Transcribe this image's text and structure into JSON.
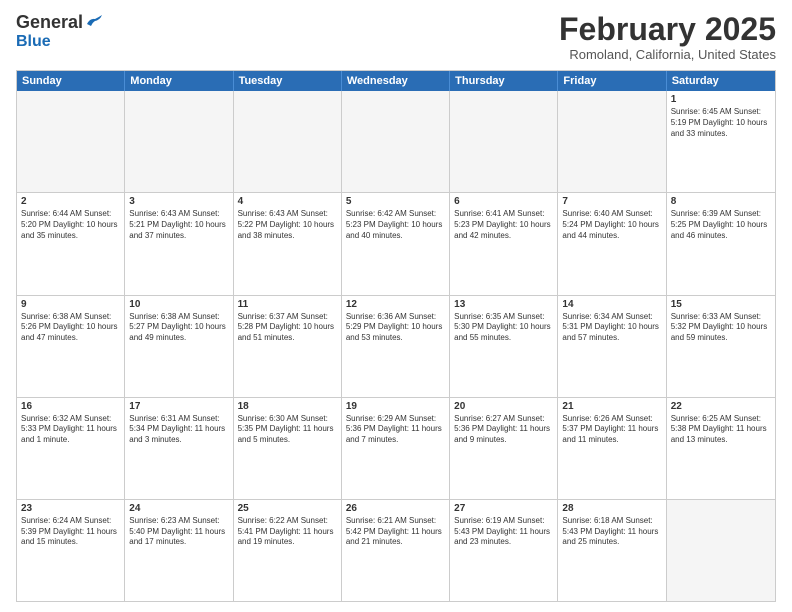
{
  "header": {
    "logo": {
      "general": "General",
      "blue": "Blue"
    },
    "title": "February 2025",
    "location": "Romoland, California, United States"
  },
  "calendar": {
    "days_of_week": [
      "Sunday",
      "Monday",
      "Tuesday",
      "Wednesday",
      "Thursday",
      "Friday",
      "Saturday"
    ],
    "rows": [
      [
        {
          "day": "",
          "empty": true,
          "text": ""
        },
        {
          "day": "",
          "empty": true,
          "text": ""
        },
        {
          "day": "",
          "empty": true,
          "text": ""
        },
        {
          "day": "",
          "empty": true,
          "text": ""
        },
        {
          "day": "",
          "empty": true,
          "text": ""
        },
        {
          "day": "",
          "empty": true,
          "text": ""
        },
        {
          "day": "1",
          "empty": false,
          "text": "Sunrise: 6:45 AM\nSunset: 5:19 PM\nDaylight: 10 hours and 33 minutes."
        }
      ],
      [
        {
          "day": "2",
          "empty": false,
          "text": "Sunrise: 6:44 AM\nSunset: 5:20 PM\nDaylight: 10 hours and 35 minutes."
        },
        {
          "day": "3",
          "empty": false,
          "text": "Sunrise: 6:43 AM\nSunset: 5:21 PM\nDaylight: 10 hours and 37 minutes."
        },
        {
          "day": "4",
          "empty": false,
          "text": "Sunrise: 6:43 AM\nSunset: 5:22 PM\nDaylight: 10 hours and 38 minutes."
        },
        {
          "day": "5",
          "empty": false,
          "text": "Sunrise: 6:42 AM\nSunset: 5:23 PM\nDaylight: 10 hours and 40 minutes."
        },
        {
          "day": "6",
          "empty": false,
          "text": "Sunrise: 6:41 AM\nSunset: 5:23 PM\nDaylight: 10 hours and 42 minutes."
        },
        {
          "day": "7",
          "empty": false,
          "text": "Sunrise: 6:40 AM\nSunset: 5:24 PM\nDaylight: 10 hours and 44 minutes."
        },
        {
          "day": "8",
          "empty": false,
          "text": "Sunrise: 6:39 AM\nSunset: 5:25 PM\nDaylight: 10 hours and 46 minutes."
        }
      ],
      [
        {
          "day": "9",
          "empty": false,
          "text": "Sunrise: 6:38 AM\nSunset: 5:26 PM\nDaylight: 10 hours and 47 minutes."
        },
        {
          "day": "10",
          "empty": false,
          "text": "Sunrise: 6:38 AM\nSunset: 5:27 PM\nDaylight: 10 hours and 49 minutes."
        },
        {
          "day": "11",
          "empty": false,
          "text": "Sunrise: 6:37 AM\nSunset: 5:28 PM\nDaylight: 10 hours and 51 minutes."
        },
        {
          "day": "12",
          "empty": false,
          "text": "Sunrise: 6:36 AM\nSunset: 5:29 PM\nDaylight: 10 hours and 53 minutes."
        },
        {
          "day": "13",
          "empty": false,
          "text": "Sunrise: 6:35 AM\nSunset: 5:30 PM\nDaylight: 10 hours and 55 minutes."
        },
        {
          "day": "14",
          "empty": false,
          "text": "Sunrise: 6:34 AM\nSunset: 5:31 PM\nDaylight: 10 hours and 57 minutes."
        },
        {
          "day": "15",
          "empty": false,
          "text": "Sunrise: 6:33 AM\nSunset: 5:32 PM\nDaylight: 10 hours and 59 minutes."
        }
      ],
      [
        {
          "day": "16",
          "empty": false,
          "text": "Sunrise: 6:32 AM\nSunset: 5:33 PM\nDaylight: 11 hours and 1 minute."
        },
        {
          "day": "17",
          "empty": false,
          "text": "Sunrise: 6:31 AM\nSunset: 5:34 PM\nDaylight: 11 hours and 3 minutes."
        },
        {
          "day": "18",
          "empty": false,
          "text": "Sunrise: 6:30 AM\nSunset: 5:35 PM\nDaylight: 11 hours and 5 minutes."
        },
        {
          "day": "19",
          "empty": false,
          "text": "Sunrise: 6:29 AM\nSunset: 5:36 PM\nDaylight: 11 hours and 7 minutes."
        },
        {
          "day": "20",
          "empty": false,
          "text": "Sunrise: 6:27 AM\nSunset: 5:36 PM\nDaylight: 11 hours and 9 minutes."
        },
        {
          "day": "21",
          "empty": false,
          "text": "Sunrise: 6:26 AM\nSunset: 5:37 PM\nDaylight: 11 hours and 11 minutes."
        },
        {
          "day": "22",
          "empty": false,
          "text": "Sunrise: 6:25 AM\nSunset: 5:38 PM\nDaylight: 11 hours and 13 minutes."
        }
      ],
      [
        {
          "day": "23",
          "empty": false,
          "text": "Sunrise: 6:24 AM\nSunset: 5:39 PM\nDaylight: 11 hours and 15 minutes."
        },
        {
          "day": "24",
          "empty": false,
          "text": "Sunrise: 6:23 AM\nSunset: 5:40 PM\nDaylight: 11 hours and 17 minutes."
        },
        {
          "day": "25",
          "empty": false,
          "text": "Sunrise: 6:22 AM\nSunset: 5:41 PM\nDaylight: 11 hours and 19 minutes."
        },
        {
          "day": "26",
          "empty": false,
          "text": "Sunrise: 6:21 AM\nSunset: 5:42 PM\nDaylight: 11 hours and 21 minutes."
        },
        {
          "day": "27",
          "empty": false,
          "text": "Sunrise: 6:19 AM\nSunset: 5:43 PM\nDaylight: 11 hours and 23 minutes."
        },
        {
          "day": "28",
          "empty": false,
          "text": "Sunrise: 6:18 AM\nSunset: 5:43 PM\nDaylight: 11 hours and 25 minutes."
        },
        {
          "day": "",
          "empty": true,
          "text": ""
        }
      ]
    ]
  }
}
